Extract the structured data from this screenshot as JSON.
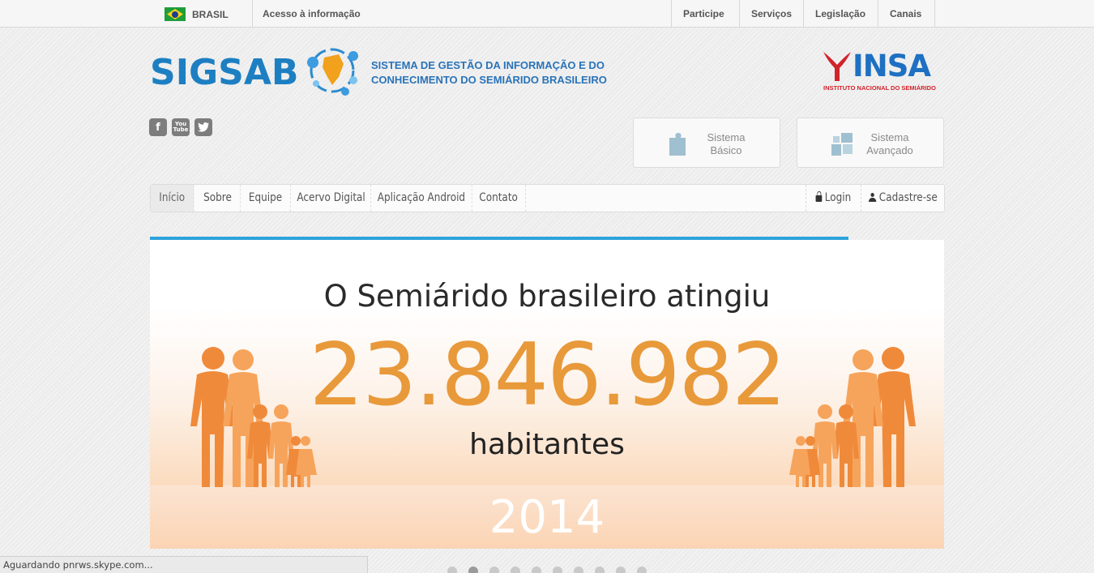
{
  "gov_bar": {
    "country": "BRASIL",
    "access_info": "Acesso à informação",
    "links": [
      "Participe",
      "Serviços",
      "Legislação",
      "Canais"
    ]
  },
  "header": {
    "logo": "SIGSAB",
    "tagline_line1": "SISTEMA DE GESTÃO DA INFORMAÇÃO E DO",
    "tagline_line2": "CONHECIMENTO DO SEMIÁRIDO BRASILEIRO",
    "partner_logo": "INSA",
    "partner_subtitle": "INSTITUTO NACIONAL DO SEMIÁRIDO"
  },
  "social": {
    "facebook": "f",
    "youtube_line1": "You",
    "youtube_line2": "Tube"
  },
  "systems": {
    "basic_line1": "Sistema",
    "basic_line2": "Básico",
    "advanced_line1": "Sistema",
    "advanced_line2": "Avançado"
  },
  "nav": {
    "items": [
      "Início",
      "Sobre",
      "Equipe",
      "Acervo Digital",
      "Aplicação Android",
      "Contato"
    ],
    "login": "Login",
    "register": "Cadastre-se"
  },
  "slider": {
    "progress_fraction": 0.88,
    "headline": "O Semiárido brasileiro atingiu",
    "number": "23.846.982",
    "unit": "habitantes",
    "year": "2014",
    "slide_count": 10,
    "active_slide": 2
  },
  "colors": {
    "brand_blue": "#1d7fc2",
    "accent_orange": "#e8993a",
    "progress_blue": "#2ea3dc",
    "insa_red": "#d1232a"
  },
  "icons": [
    "brazil-flag-icon",
    "facebook-icon",
    "youtube-icon",
    "twitter-icon",
    "puzzle-piece-icon",
    "puzzle-pieces-icon",
    "lock-icon",
    "user-icon"
  ],
  "status_bar": "Aguardando pnrws.skype.com..."
}
